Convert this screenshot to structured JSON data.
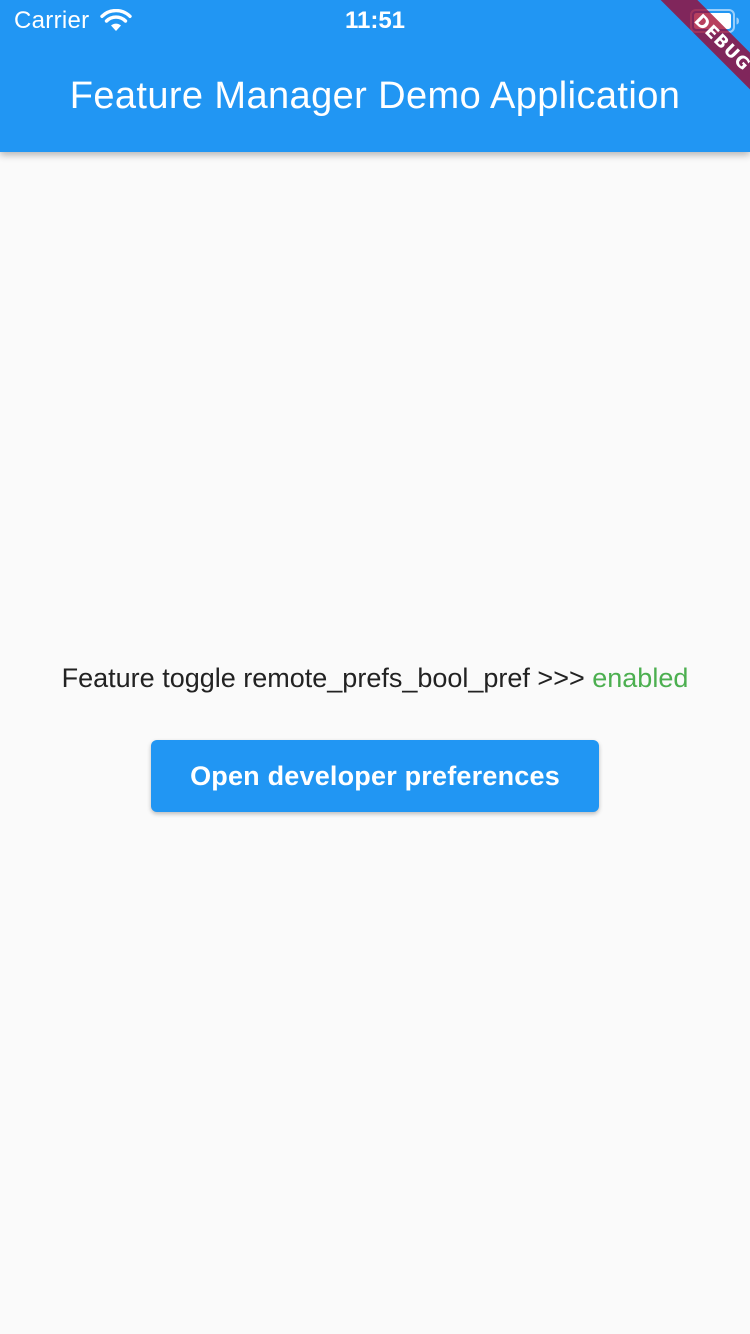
{
  "status_bar": {
    "carrier": "Carrier",
    "time": "11:51",
    "wifi_icon": "wifi-icon",
    "battery_icon": "battery-icon"
  },
  "app_bar": {
    "title": "Feature Manager Demo Application",
    "color": "#2196f3"
  },
  "debug_banner": {
    "label": "DEBUG"
  },
  "main": {
    "toggle_prefix": "Feature toggle remote_prefs_bool_pref >>> ",
    "toggle_value": "enabled",
    "toggle_value_color": "#4caf50",
    "button_label": "Open developer preferences"
  }
}
